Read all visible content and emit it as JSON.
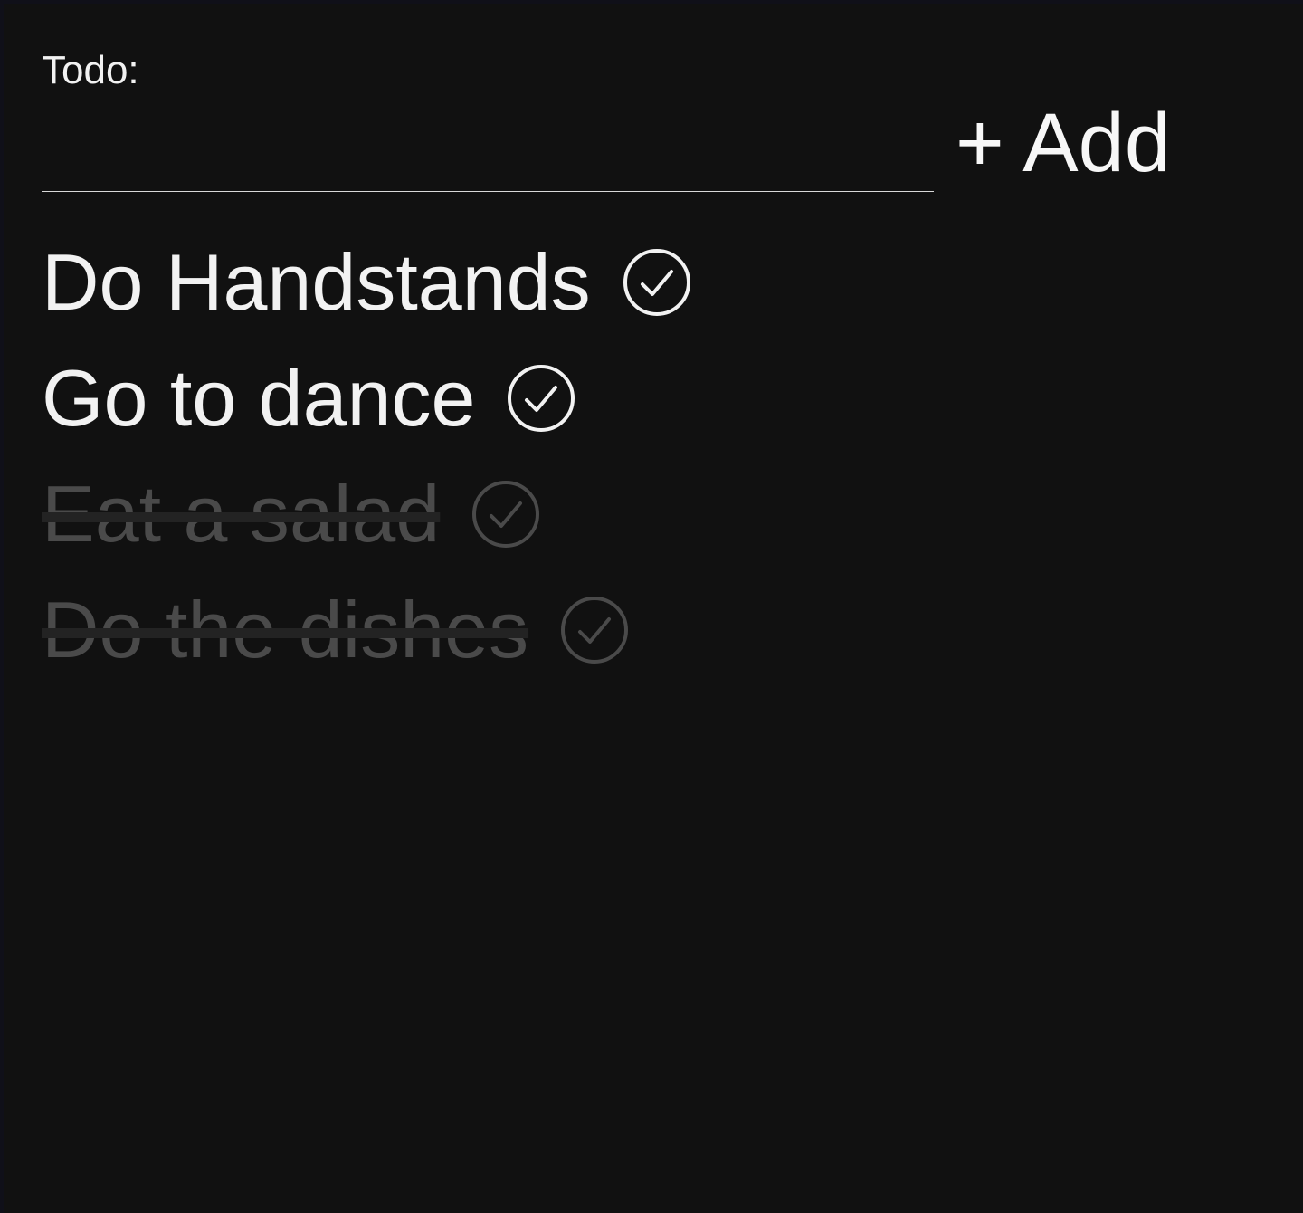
{
  "form": {
    "label": "Todo:",
    "input_value": "",
    "input_placeholder": "",
    "add_button_label": "+ Add"
  },
  "todos": [
    {
      "text": "Do Handstands",
      "done": false,
      "icon": "check-circle-icon"
    },
    {
      "text": "Go to dance",
      "done": false,
      "icon": "check-circle-icon"
    },
    {
      "text": "Eat a salad",
      "done": true,
      "icon": "check-circle-icon"
    },
    {
      "text": "Do the dishes",
      "done": true,
      "icon": "check-circle-icon"
    }
  ],
  "colors": {
    "background": "#111111",
    "outer_border": "#101019",
    "text": "#f2f2f2",
    "done_text": "#4a4a4a",
    "strike": "#232323"
  }
}
